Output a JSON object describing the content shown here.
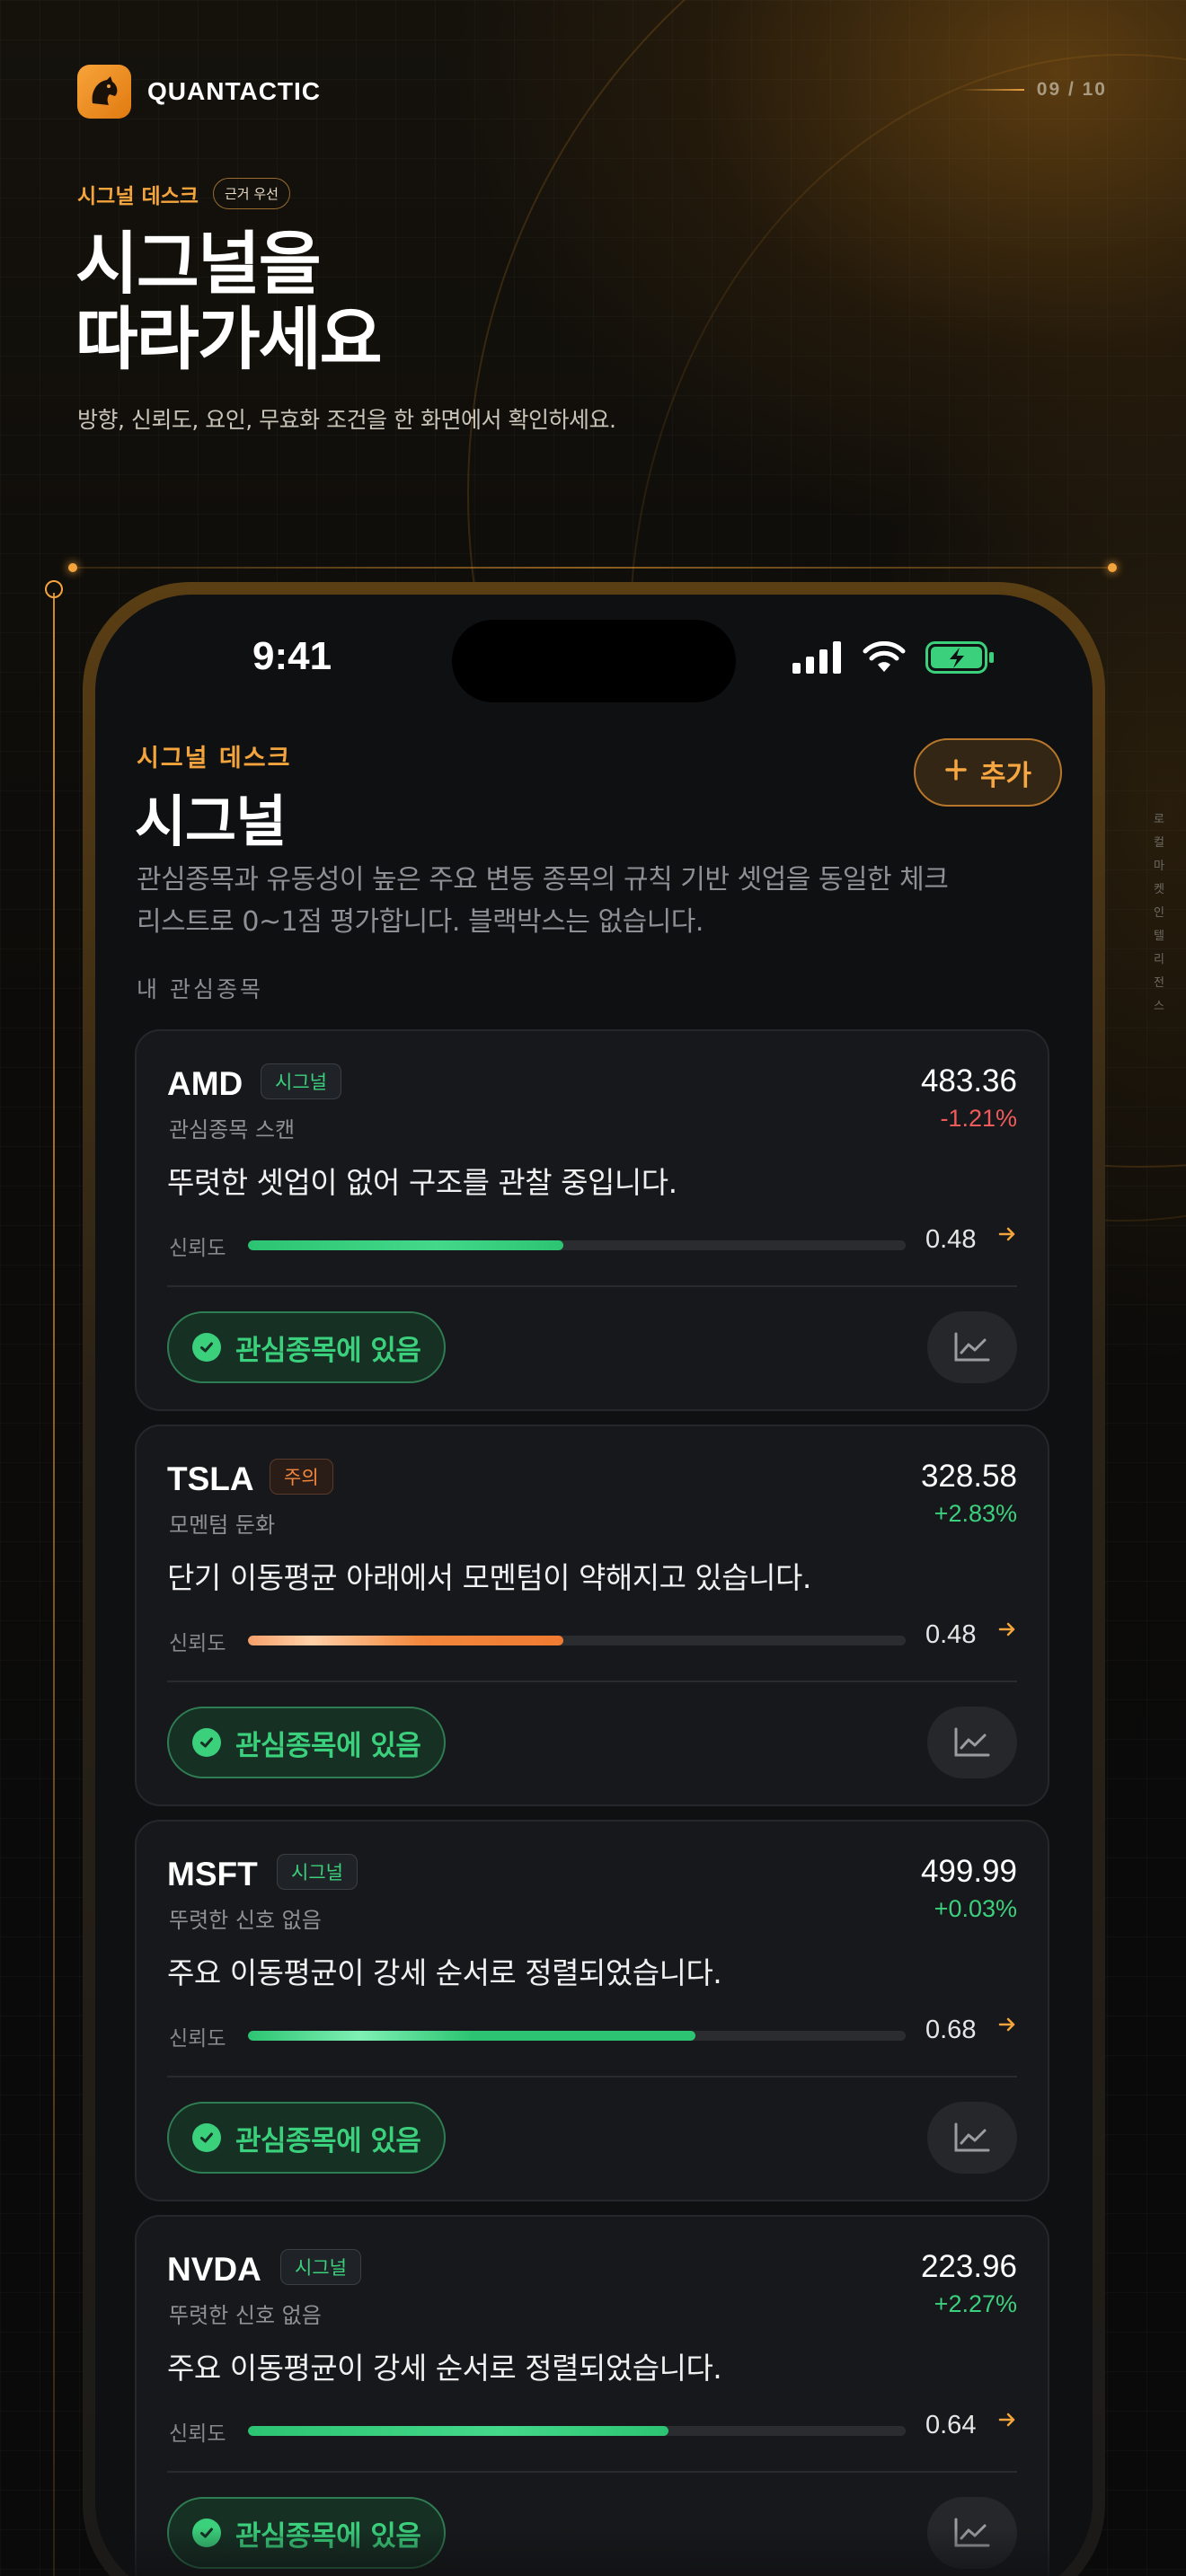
{
  "brand": {
    "name": "QUANTACTIC",
    "icon": "horse-head-icon"
  },
  "pager": {
    "label": "09 / 10"
  },
  "hero": {
    "eyebrow": "시그널 데스크",
    "eyebrow_chip": "근거 우선",
    "title_line1": "시그널을",
    "title_line2": "따라가세요",
    "subtitle": "방향, 신뢰도, 요인, 무효화 조건을 한 화면에서 확인하세요."
  },
  "side_label": "로컬 마켓 인텔리전스",
  "phone": {
    "time": "9:41",
    "desk_label": "시그널 데스크",
    "title": "시그널",
    "add_button": "추가",
    "description": "관심종목과 유동성이 높은 주요 변동 종목의 규칙 기반 셋업을 동일한 체크리스트로 0~1점 평가합니다. 블랙박스는 없습니다.",
    "section_label": "내 관심종목",
    "confidence_label": "신뢰도",
    "watch_label": "관심종목에 있음",
    "cards": [
      {
        "ticker": "AMD",
        "tag": "시그널",
        "tag_type": "sig",
        "subtitle": "관심종목 스캔",
        "price": "483.36",
        "change": "-1.21%",
        "direction": "down",
        "message": "뚜렷한 셋업이 없어 구조를 관찰 중입니다.",
        "confidence": "0.48",
        "confidence_value": 0.48,
        "bar_style": "green"
      },
      {
        "ticker": "TSLA",
        "tag": "주의",
        "tag_type": "warn",
        "subtitle": "모멘텀 둔화",
        "price": "328.58",
        "change": "+2.83%",
        "direction": "up",
        "message": "단기 이동평균 아래에서 모멘텀이 약해지고 있습니다.",
        "confidence": "0.48",
        "confidence_value": 0.48,
        "bar_style": "orange"
      },
      {
        "ticker": "MSFT",
        "tag": "시그널",
        "tag_type": "sig",
        "subtitle": "뚜렷한 신호 없음",
        "price": "499.99",
        "change": "+0.03%",
        "direction": "up",
        "message": "주요 이동평균이 강세 순서로 정렬되었습니다.",
        "confidence": "0.68",
        "confidence_value": 0.68,
        "bar_style": "green2"
      },
      {
        "ticker": "NVDA",
        "tag": "시그널",
        "tag_type": "sig",
        "subtitle": "뚜렷한 신호 없음",
        "price": "223.96",
        "change": "+2.27%",
        "direction": "up",
        "message": "주요 이동평균이 강세 순서로 정렬되었습니다.",
        "confidence": "0.64",
        "confidence_value": 0.64,
        "bar_style": "green"
      }
    ]
  },
  "colors": {
    "accent": "#f4a43d",
    "positive": "#3bd07c",
    "negative": "#ef5b5b",
    "warning": "#f3873c"
  }
}
